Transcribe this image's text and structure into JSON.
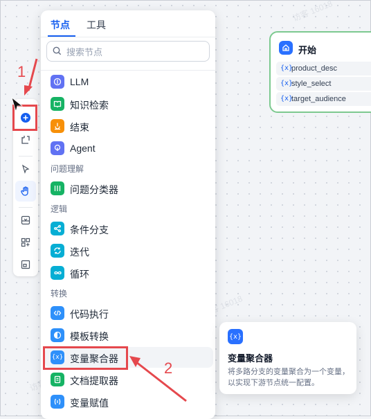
{
  "panel": {
    "tabs": [
      {
        "label": "节点",
        "active": true
      },
      {
        "label": "工具",
        "active": false
      }
    ],
    "search": {
      "placeholder": "搜索节点",
      "value": ""
    },
    "items": [
      {
        "label": "LLM",
        "icon": "llm-icon",
        "color": "#6172f3"
      },
      {
        "label": "知识检索",
        "icon": "knowledge-icon",
        "color": "#16b364"
      },
      {
        "label": "结束",
        "icon": "end-icon",
        "color": "#f79009"
      },
      {
        "label": "Agent",
        "icon": "agent-icon",
        "color": "#6172f3"
      },
      {
        "label": "问题分类器",
        "icon": "classifier-icon",
        "color": "#16b364"
      },
      {
        "label": "条件分支",
        "icon": "branch-icon",
        "color": "#06aed4"
      },
      {
        "label": "迭代",
        "icon": "iteration-icon",
        "color": "#06aed4"
      },
      {
        "label": "循环",
        "icon": "loop-icon",
        "color": "#06aed4"
      },
      {
        "label": "代码执行",
        "icon": "code-icon",
        "color": "#2e90fa"
      },
      {
        "label": "模板转换",
        "icon": "template-icon",
        "color": "#2e90fa"
      },
      {
        "label": "变量聚合器",
        "icon": "aggregator-icon",
        "color": "#2e90fa"
      },
      {
        "label": "文档提取器",
        "icon": "doc-extractor-icon",
        "color": "#16b364"
      },
      {
        "label": "变量赋值",
        "icon": "assigner-icon",
        "color": "#2e90fa"
      }
    ],
    "categories": [
      "问题理解",
      "逻辑",
      "转换"
    ]
  },
  "start_node": {
    "title": "开始",
    "variables": [
      "product_desc",
      "style_select",
      "target_audience"
    ]
  },
  "tooltip": {
    "title": "变量聚合器",
    "description": "将多路分支的变量聚合为一个变量，以实现下游节点统一配置。"
  },
  "annotations": {
    "step1": "1",
    "step2": "2"
  },
  "watermark": "访客 16018",
  "colors": {
    "accent": "#155eef",
    "annotation": "#e5484d",
    "start_border": "#7cc98f"
  }
}
